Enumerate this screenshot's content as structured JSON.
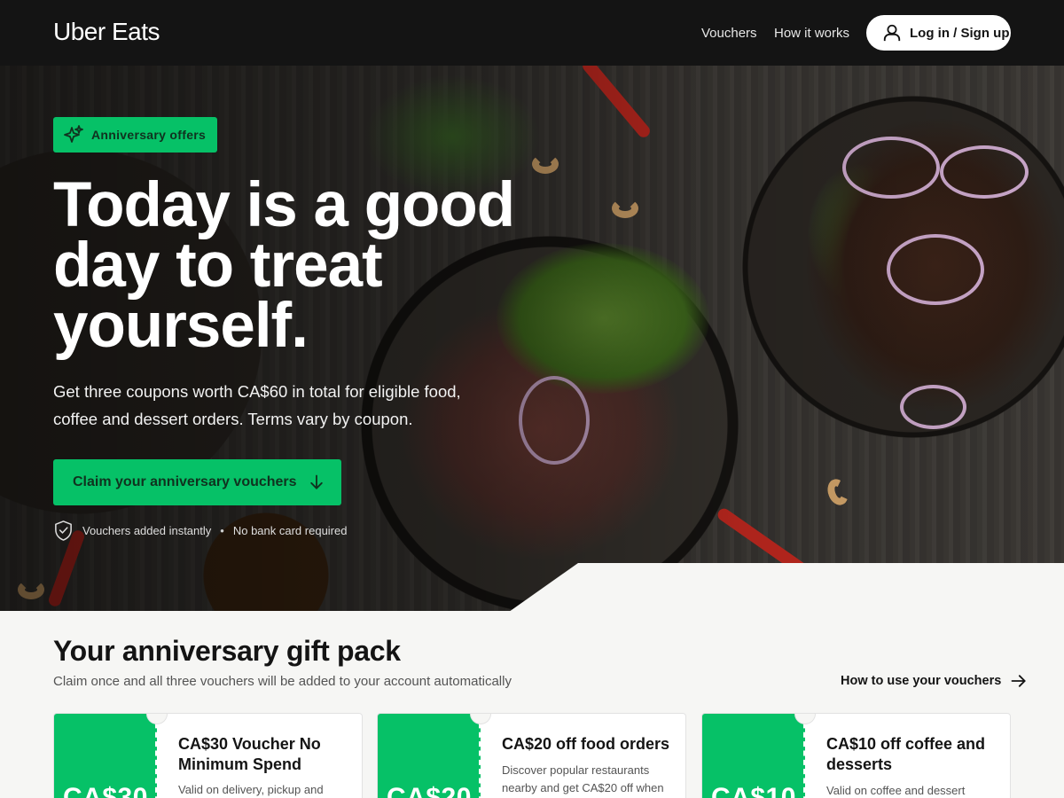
{
  "header": {
    "logo": "Uber Eats",
    "nav": {
      "vouchers": "Vouchers",
      "how_it_works": "How it works"
    },
    "login_label": "Log in / Sign up"
  },
  "hero": {
    "badge": "Anniversary offers",
    "title": "Today is a good day to treat yourself.",
    "subtitle": "Get three coupons worth CA$60 in total for eligible food, coffee and dessert orders. Terms vary by coupon.",
    "cta_label": "Claim your anniversary vouchers",
    "assurance_1": "Vouchers added instantly",
    "assurance_sep": "•",
    "assurance_2": "No bank card required"
  },
  "gift": {
    "title": "Your anniversary gift pack",
    "subtitle": "Claim once and all three vouchers will be added to your account automatically",
    "how_link": "How to use your vouchers",
    "cards": [
      {
        "amount": "CA$30",
        "title": "CA$30 Voucher No Minimum Spend",
        "desc": "Valid on delivery, pickup and dine-"
      },
      {
        "amount": "CA$20",
        "title": "CA$20 off food orders",
        "desc": "Discover popular restaurants nearby and get CA$20 off when"
      },
      {
        "amount": "CA$10",
        "title": "CA$10 off coffee and desserts",
        "desc": "Valid on coffee and dessert"
      }
    ]
  },
  "colors": {
    "brand_green": "#06c167",
    "header_bg": "#141414",
    "page_bg": "#f6f6f4"
  },
  "icons": [
    "user-icon",
    "sparkle-icon",
    "arrow-down-icon",
    "shield-check-icon",
    "arrow-right-icon"
  ]
}
